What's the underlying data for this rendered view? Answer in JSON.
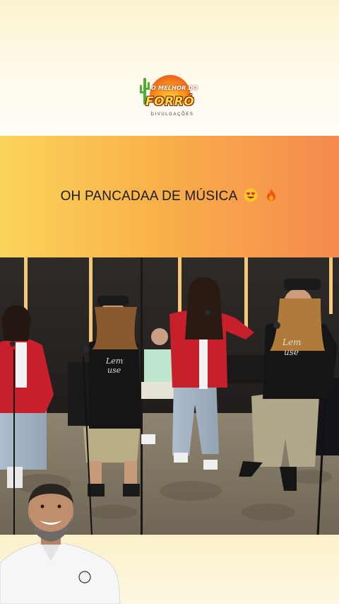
{
  "logo": {
    "line1": "O MELHOR DO",
    "line2": "FORRÓ",
    "line3": "DIVULGAÇÕES",
    "icon": "cactus-sun-logo"
  },
  "post": {
    "headline": "OH PANCADAA DE MÚSICA",
    "emojis": [
      "heart-eyes-emoji",
      "fire-emoji"
    ]
  },
  "video": {
    "shirt_text_left": "Lem\nuse",
    "shirt_text_right": "Lem\nuse"
  },
  "colors": {
    "top_band": "#fbf3cf",
    "band_yellow": "#fbd45a",
    "band_orange": "#f58a4e",
    "jacket_red": "#c8202a"
  }
}
